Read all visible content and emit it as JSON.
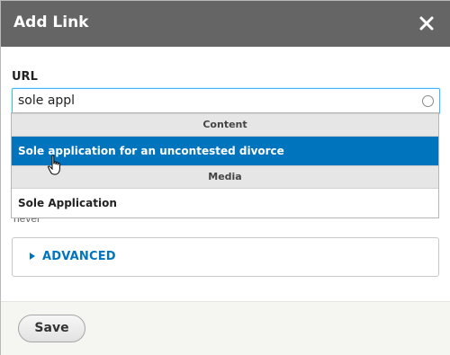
{
  "dialog": {
    "title": "Add Link",
    "close_icon": "close-icon"
  },
  "url_field": {
    "label": "URL",
    "value": "sole appl"
  },
  "helper_text": "never",
  "autocomplete": {
    "groups": [
      {
        "label": "Content",
        "items": [
          {
            "label": "Sole application for an uncontested divorce",
            "selected": true
          }
        ]
      },
      {
        "label": "Media",
        "items": [
          {
            "label": "Sole Application",
            "selected": false
          }
        ]
      }
    ]
  },
  "advanced": {
    "label": "ADVANCED"
  },
  "footer": {
    "save_label": "Save"
  },
  "colors": {
    "titlebar": "#656565",
    "accent": "#0074bd",
    "input_focus": "#40b6ff"
  }
}
